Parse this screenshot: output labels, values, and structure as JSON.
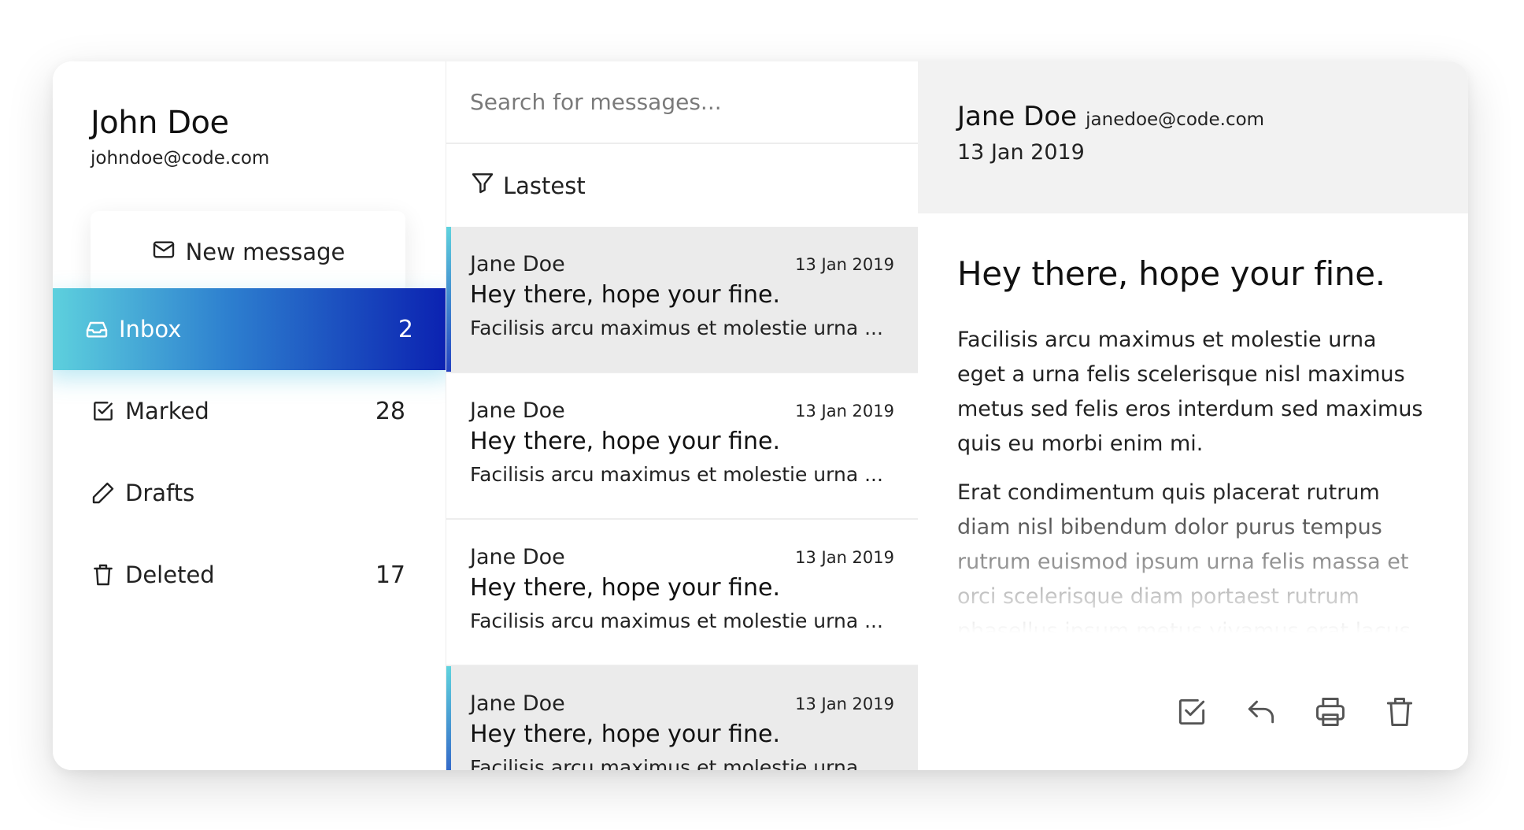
{
  "user": {
    "name": "John Doe",
    "email": "johndoe@code.com"
  },
  "new_message_label": "New message",
  "nav": [
    {
      "label": "Inbox",
      "count": "2",
      "icon": "inbox-icon"
    },
    {
      "label": "Marked",
      "count": "28",
      "icon": "check-square-icon"
    },
    {
      "label": "Drafts",
      "count": "",
      "icon": "pencil-icon"
    },
    {
      "label": "Deleted",
      "count": "17",
      "icon": "trash-icon"
    }
  ],
  "search": {
    "placeholder": "Search for messages..."
  },
  "filter_label": "Lastest",
  "messages": [
    {
      "sender": "Jane Doe",
      "date": "13 Jan 2019",
      "subject": "Hey there, hope your fine.",
      "preview": "Facilisis arcu maximus et molestie urna ..."
    },
    {
      "sender": "Jane Doe",
      "date": "13 Jan 2019",
      "subject": "Hey there, hope your fine.",
      "preview": "Facilisis arcu maximus et molestie urna ..."
    },
    {
      "sender": "Jane Doe",
      "date": "13 Jan 2019",
      "subject": "Hey there, hope your fine.",
      "preview": "Facilisis arcu maximus et molestie urna ..."
    },
    {
      "sender": "Jane Doe",
      "date": "13 Jan 2019",
      "subject": "Hey there, hope your fine.",
      "preview": "Facilisis arcu maximus et molestie urna ..."
    }
  ],
  "reader": {
    "from_name": "Jane Doe",
    "from_email": "janedoe@code.com",
    "date": "13 Jan 2019",
    "subject": "Hey there, hope your fine.",
    "paragraphs": [
      "Facilisis arcu maximus et molestie urna eget a urna felis scelerisque nisl maximus metus sed felis eros interdum sed maximus quis eu morbi enim mi.",
      "Erat condimentum quis placerat rutrum diam nisl bibendum dolor purus tempus rutrum euismod ipsum urna felis massa et orci scelerisque diam portaest rutrum phasellus ipsum metus vivamus erat lacus"
    ],
    "actions": [
      "check-square-icon",
      "reply-icon",
      "printer-icon",
      "trash-icon"
    ]
  },
  "colors": {
    "accent_gradient_start": "#5fd3de",
    "accent_gradient_end": "#0a1fb0",
    "selected_row_bg": "#ebebeb",
    "reader_header_bg": "#f2f2f2"
  }
}
